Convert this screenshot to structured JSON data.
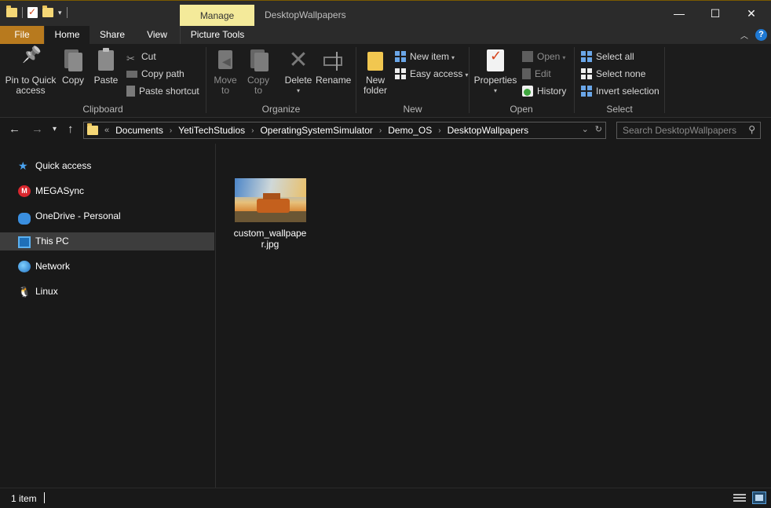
{
  "window": {
    "title": "DesktopWallpapers",
    "contextual_tab": "Manage",
    "controls": {
      "minimize": "—",
      "maximize": "☐",
      "close": "✕"
    }
  },
  "ribbon_tabs": [
    "File",
    "Home",
    "Share",
    "View",
    "Picture Tools"
  ],
  "ribbon": {
    "clipboard": {
      "label": "Clipboard",
      "pin": "Pin to Quick access",
      "copy": "Copy",
      "paste": "Paste",
      "cut": "Cut",
      "copy_path": "Copy path",
      "paste_shortcut": "Paste shortcut"
    },
    "organize": {
      "label": "Organize",
      "move_to": "Move to",
      "copy_to": "Copy to",
      "delete": "Delete",
      "rename": "Rename"
    },
    "new": {
      "label": "New",
      "new_folder": "New folder",
      "new_item": "New item",
      "easy_access": "Easy access"
    },
    "open": {
      "label": "Open",
      "properties": "Properties",
      "open": "Open",
      "edit": "Edit",
      "history": "History"
    },
    "select": {
      "label": "Select",
      "select_all": "Select all",
      "select_none": "Select none",
      "invert_selection": "Invert selection"
    }
  },
  "address": {
    "overflow": "«",
    "crumbs": [
      "Documents",
      "YetiTechStudios",
      "OperatingSystemSimulator",
      "Demo_OS",
      "DesktopWallpapers"
    ],
    "search_placeholder": "Search DesktopWallpapers"
  },
  "sidebar": {
    "items": [
      {
        "label": "Quick access",
        "icon": "star-icon"
      },
      {
        "label": "MEGASync",
        "icon": "mega-icon"
      },
      {
        "label": "OneDrive - Personal",
        "icon": "cloud-icon"
      },
      {
        "label": "This PC",
        "icon": "computer-icon"
      },
      {
        "label": "Network",
        "icon": "network-icon"
      },
      {
        "label": "Linux",
        "icon": "linux-icon"
      }
    ]
  },
  "files": [
    {
      "name": "custom_wallpaper.jpg"
    }
  ],
  "status": {
    "item_count": "1 item"
  }
}
